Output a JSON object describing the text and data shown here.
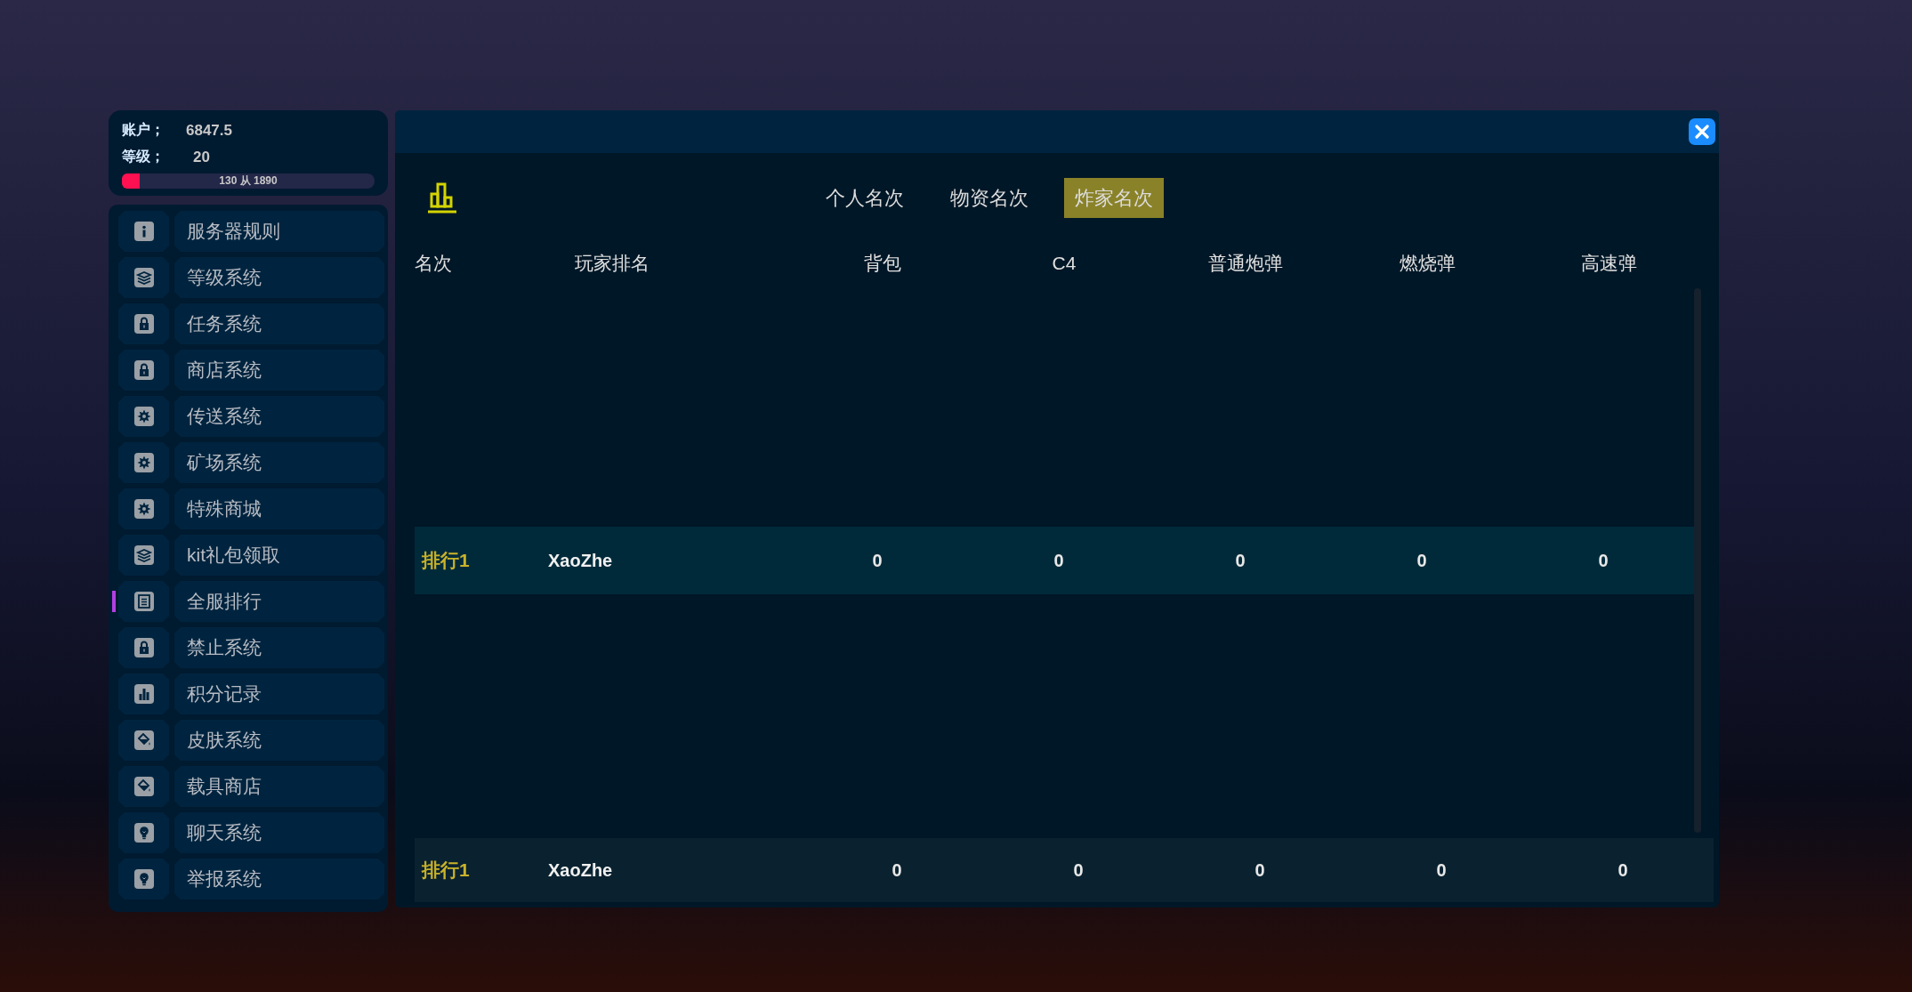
{
  "account": {
    "label": "账户；",
    "value": "6847.5"
  },
  "level_info": {
    "label": "等级；",
    "value": "20"
  },
  "progress": {
    "level": 0.069,
    "text": "130 从 1890"
  },
  "sidebar": {
    "items": [
      {
        "label": "服务器规则",
        "kind": "info",
        "selected": false
      },
      {
        "label": "等级系统",
        "kind": "layers",
        "selected": false
      },
      {
        "label": "任务系统",
        "kind": "lock",
        "selected": false
      },
      {
        "label": "商店系统",
        "kind": "lock",
        "selected": false
      },
      {
        "label": "传送系统",
        "kind": "gear",
        "selected": false
      },
      {
        "label": "矿场系统",
        "kind": "gear",
        "selected": false
      },
      {
        "label": "特殊商城",
        "kind": "gear",
        "selected": false
      },
      {
        "label": "kit礼包领取",
        "kind": "layers",
        "selected": false
      },
      {
        "label": "全服排行",
        "kind": "list",
        "selected": true
      },
      {
        "label": "禁止系统",
        "kind": "lock",
        "selected": false
      },
      {
        "label": "积分记录",
        "kind": "chart",
        "selected": false
      },
      {
        "label": "皮肤系统",
        "kind": "bucket",
        "selected": false
      },
      {
        "label": "载具商店",
        "kind": "bucket",
        "selected": false
      },
      {
        "label": "聊天系统",
        "kind": "bulb",
        "selected": false
      },
      {
        "label": "举报系统",
        "kind": "bulb",
        "selected": false
      }
    ]
  },
  "panel": {
    "tabs": [
      {
        "label": "个人名次",
        "selected": false
      },
      {
        "label": "物资名次",
        "selected": false
      },
      {
        "label": "炸家名次",
        "selected": true
      }
    ],
    "columns": [
      "名次",
      "玩家排名",
      "背包",
      "C4",
      "普通炮弹",
      "燃烧弹",
      "高速弹"
    ],
    "rows": [
      {
        "rank": "排行1",
        "player": "XaoZhe",
        "values": [
          "0",
          "0",
          "0",
          "0",
          "0"
        ]
      }
    ],
    "footer_row": {
      "rank": "排行1",
      "player": "XaoZhe",
      "values": [
        "0",
        "0",
        "0",
        "0",
        "0"
      ]
    }
  }
}
